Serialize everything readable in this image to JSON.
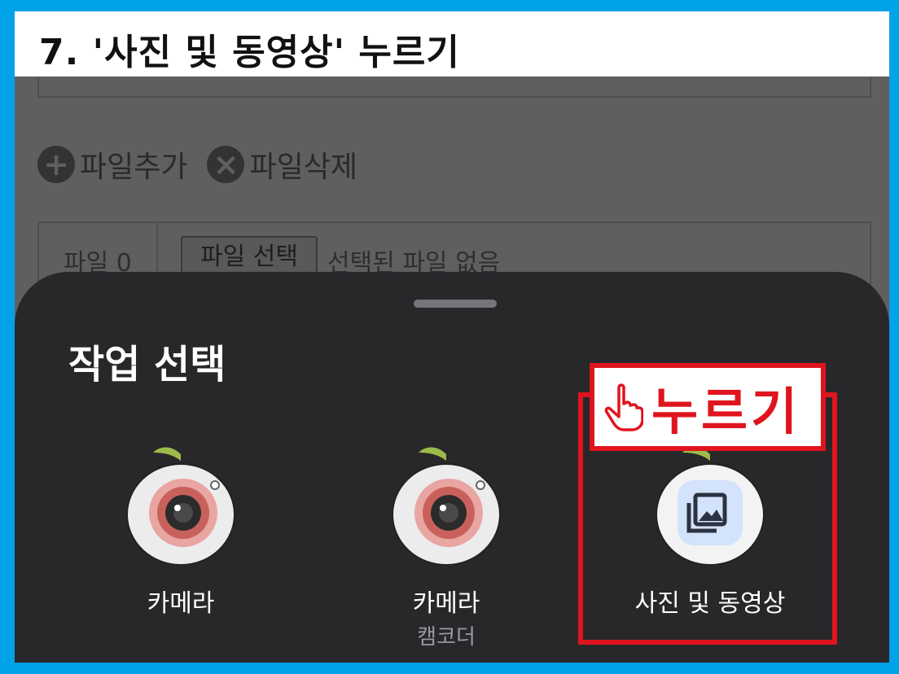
{
  "title": "7. '사진 및 동영상' 누르기",
  "file_actions": {
    "add_label": "파일추가",
    "add_icon": "plus-circle-icon",
    "delete_label": "파일삭제",
    "delete_icon": "x-circle-icon"
  },
  "file_row": {
    "label": "파일 0",
    "select_button": "파일 선택",
    "status": "선택된 파일 없음"
  },
  "sheet": {
    "title": "작업 선택",
    "options": [
      {
        "label": "카메라",
        "sublabel": "",
        "icon": "camera-app-icon"
      },
      {
        "label": "카메라",
        "sublabel": "캠코더",
        "icon": "camcorder-app-icon"
      },
      {
        "label": "사진 및 동영상",
        "sublabel": "",
        "icon": "gallery-app-icon"
      }
    ]
  },
  "callout": {
    "text": "누르기",
    "icon": "pointing-hand-icon",
    "color": "#e0141e"
  },
  "colors": {
    "border": "#00a2e8",
    "sheet_bg": "#28272a",
    "highlight": "#e0141e"
  }
}
